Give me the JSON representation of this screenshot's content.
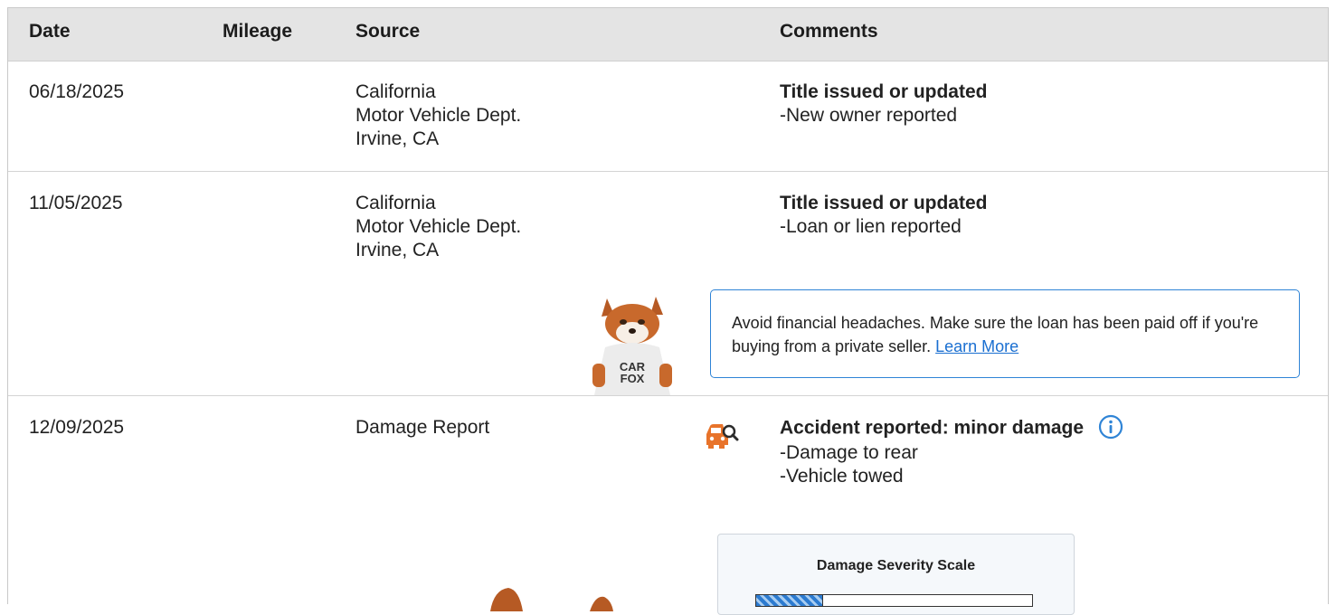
{
  "table": {
    "headers": {
      "date": "Date",
      "mileage": "Mileage",
      "source": "Source",
      "comments": "Comments"
    },
    "rows": [
      {
        "date": "06/18/2025",
        "mileage": "",
        "source": [
          "California",
          "Motor Vehicle Dept.",
          "Irvine, CA"
        ],
        "comment_title": "Title issued or updated",
        "comment_details": [
          "New owner reported"
        ]
      },
      {
        "date": "11/05/2025",
        "mileage": "",
        "source": [
          "California",
          "Motor Vehicle Dept.",
          "Irvine, CA"
        ],
        "comment_title": "Title issued or updated",
        "comment_details": [
          "Loan or lien reported"
        ]
      },
      {
        "date": "12/09/2025",
        "mileage": "",
        "source": [
          "Damage Report"
        ],
        "comment_title": "Accident reported: minor damage",
        "comment_details": [
          "Damage to rear",
          "Vehicle towed"
        ]
      }
    ]
  },
  "callout": {
    "text": "Avoid financial headaches. Make sure the loan has been paid off if you're buying from a private seller.",
    "link_label": "Learn More"
  },
  "mascot": {
    "shirt_line1": "CAR",
    "shirt_line2": "FOX"
  },
  "damage_scale": {
    "title": "Damage Severity Scale",
    "level_fraction": 0.24
  },
  "colors": {
    "accent_blue": "#2f84d6",
    "link_blue": "#1a6fd1",
    "damage_orange": "#e8732a",
    "header_bg": "#e4e4e4"
  },
  "icons": {
    "damage": "car-search-icon",
    "info": "info-icon"
  }
}
